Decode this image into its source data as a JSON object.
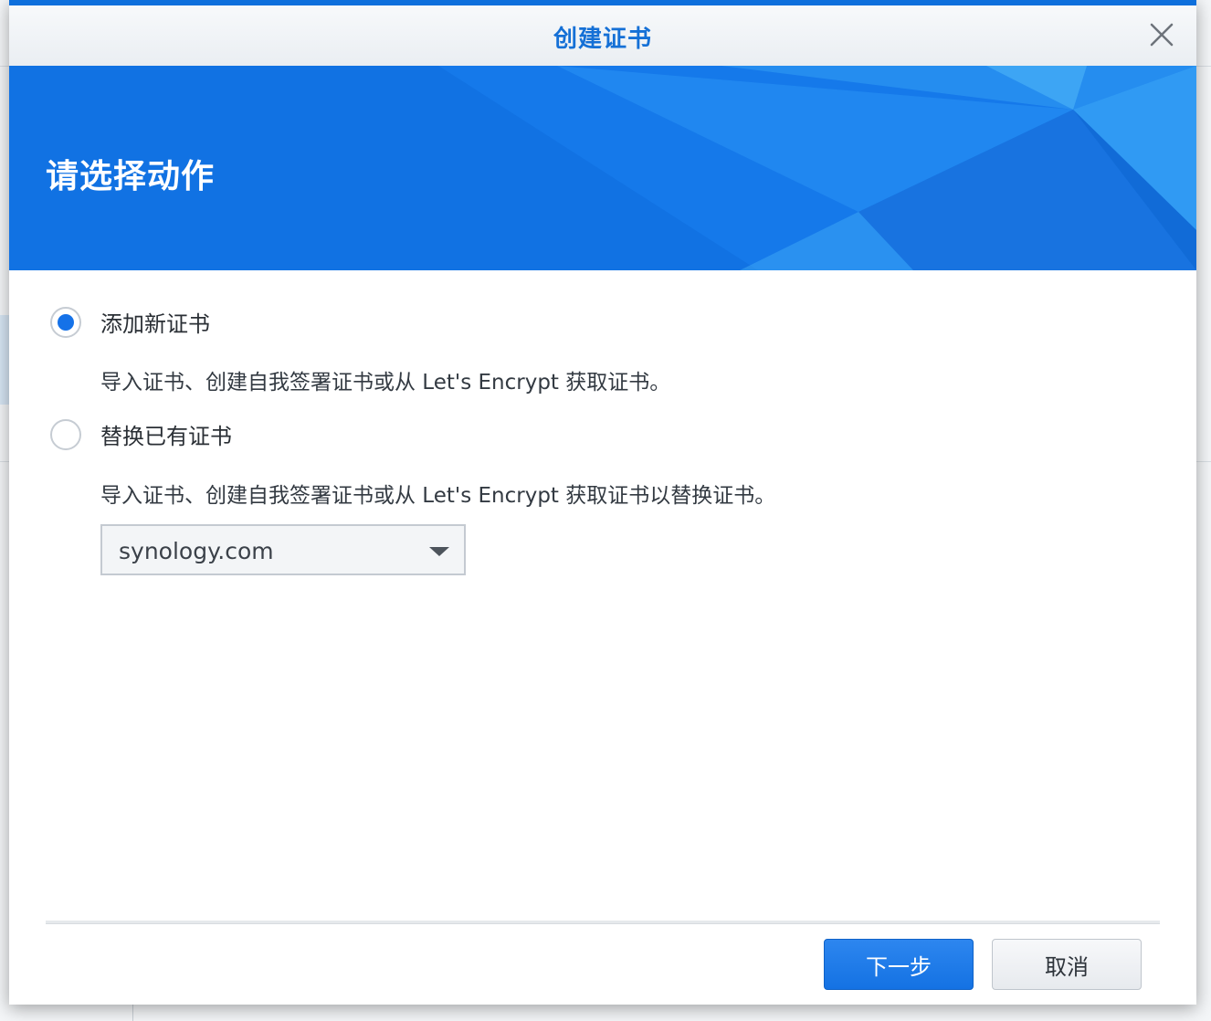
{
  "dialog": {
    "title": "创建证书",
    "banner_title": "请选择动作"
  },
  "options": [
    {
      "label": "添加新证书",
      "description": "导入证书、创建自我签署证书或从 Let's Encrypt 获取证书。",
      "selected": true
    },
    {
      "label": "替换已有证书",
      "description": "导入证书、创建自我签署证书或从 Let's Encrypt 获取证书以替换证书。",
      "selected": false
    }
  ],
  "certificate_select": {
    "value": "synology.com"
  },
  "footer": {
    "next_label": "下一步",
    "cancel_label": "取消"
  },
  "colors": {
    "accent": "#1572e8",
    "banner": "#1172e3",
    "title": "#1570d6"
  }
}
